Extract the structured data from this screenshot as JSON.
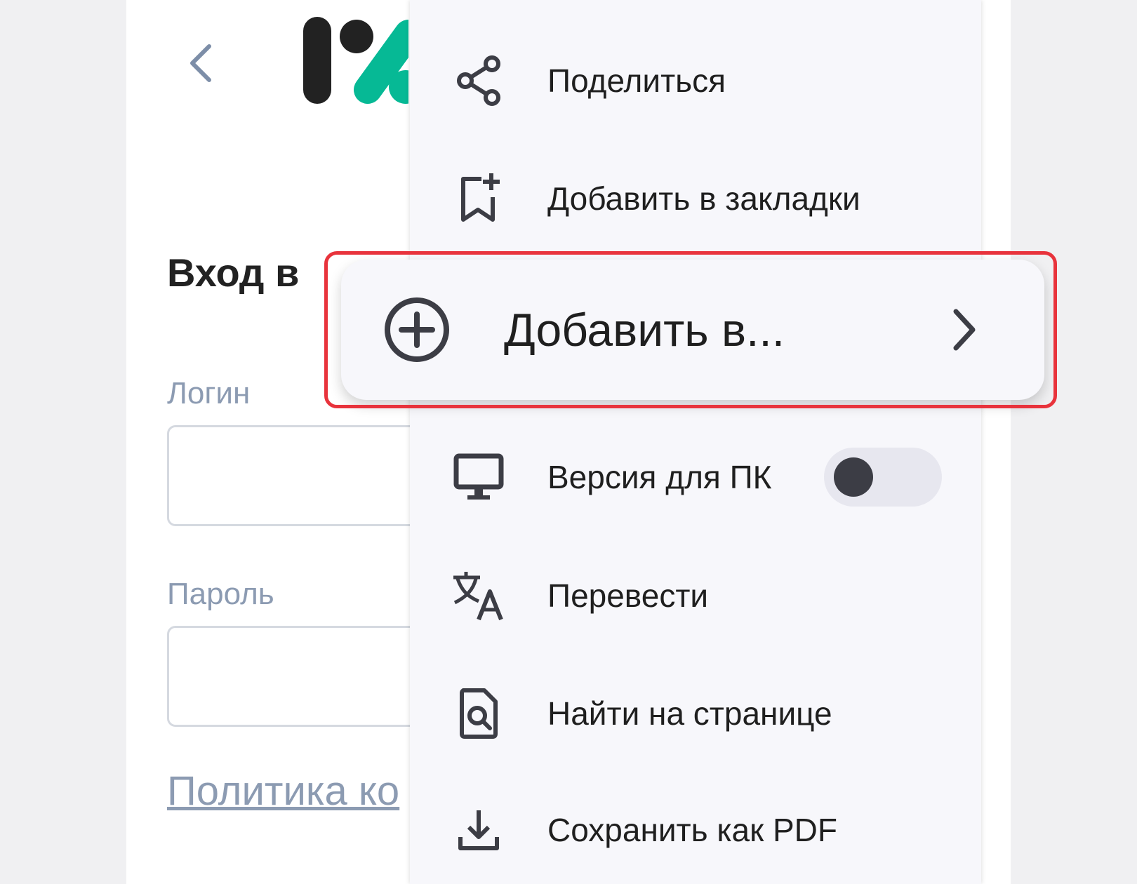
{
  "page": {
    "title": "Вход в",
    "login_label": "Логин",
    "password_label": "Пароль",
    "policy_link": "Политика ко"
  },
  "menu": {
    "share": {
      "label": "Поделиться",
      "icon": "share-icon"
    },
    "bookmark": {
      "label": "Добавить в закладки",
      "icon": "bookmark-add-icon"
    },
    "add_to": {
      "label": "Добавить в...",
      "icon": "plus-circle-icon",
      "chevron": "chevron-right-icon"
    },
    "desktop_version": {
      "label": "Версия для ПК",
      "icon": "desktop-icon",
      "toggle_on": false
    },
    "translate": {
      "label": "Перевести",
      "icon": "translate-icon"
    },
    "find": {
      "label": "Найти на странице",
      "icon": "find-in-page-icon"
    },
    "save_pdf": {
      "label": "Сохранить как PDF",
      "icon": "download-icon"
    }
  },
  "colors": {
    "highlight": "#e8333c",
    "logo_dark": "#222222",
    "logo_green": "#06b995",
    "icon": "#3c3d45",
    "muted_text": "#8c9bb2"
  }
}
